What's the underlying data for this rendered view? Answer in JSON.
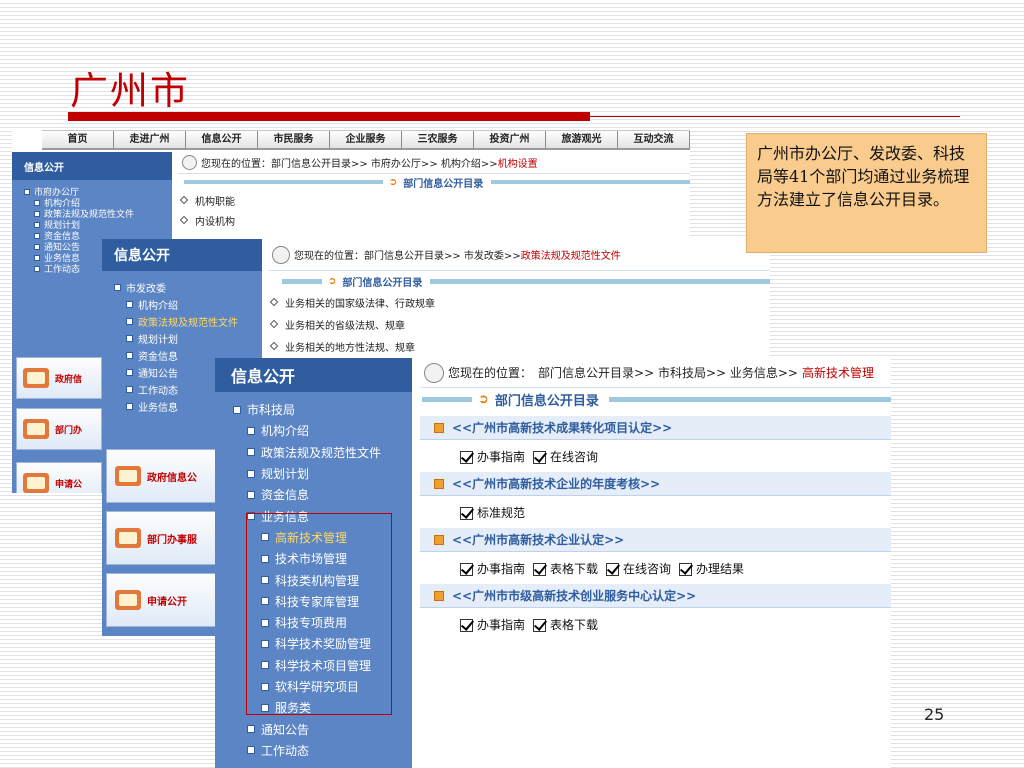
{
  "slide": {
    "title": "广州市",
    "page_number": "25",
    "note": "广州市办公厅、发改委、科技局等41个部门均通过业务梳理方法建立了信息公开目录。"
  },
  "screenshot1": {
    "nav": [
      "首页",
      "走进广州",
      "信息公开",
      "市民服务",
      "企业服务",
      "三农服务",
      "投资广州",
      "旅游观光",
      "互动交流"
    ],
    "side_title": "信息公开",
    "tree": [
      "市府办公厅",
      "机构介绍",
      "政策法规及规范性文件",
      "规划计划",
      "资金信息",
      "通知公告",
      "业务信息",
      "工作动态"
    ],
    "promos": [
      "政府信",
      "部门办",
      "申请公"
    ],
    "breadcrumb": {
      "prefix": "您现在的位置：",
      "path": "部门信息公开目录>> 市府办公厅>> 机构介绍>>",
      "current": "机构设置"
    },
    "dir_title": "部门信息公开目录",
    "links": [
      "机构职能",
      "内设机构"
    ]
  },
  "screenshot2": {
    "side_title": "信息公开",
    "tree": [
      "市发改委",
      "机构介绍",
      "政策法规及规范性文件",
      "规划计划",
      "资金信息",
      "通知公告",
      "工作动态",
      "业务信息"
    ],
    "promos": [
      "政府信息公",
      "部门办事服",
      "申请公开"
    ],
    "breadcrumb": {
      "prefix": "您现在的位置：",
      "path": "部门信息公开目录>> 市发改委>>",
      "current": "政策法规及规范性文件"
    },
    "dir_title": "部门信息公开目录",
    "links": [
      "业务相关的国家级法律、行政规章",
      "业务相关的省级法规、规章",
      "业务相关的地方性法规、规章"
    ]
  },
  "screenshot3": {
    "side_title": "信息公开",
    "tree": [
      "市科技局",
      "机构介绍",
      "政策法规及规范性文件",
      "规划计划",
      "资金信息",
      "业务信息",
      "高新技术管理",
      "技术市场管理",
      "科技类机构管理",
      "科技专家库管理",
      "科技专项费用",
      "科学技术奖励管理",
      "科学技术项目管理",
      "软科学研究项目",
      "服务类",
      "通知公告",
      "工作动态"
    ],
    "breadcrumb": {
      "prefix": "您现在的位置：",
      "path": "部门信息公开目录>> 市科技局>> 业务信息>>",
      "current": "高新技术管理"
    },
    "dir_title": "部门信息公开目录",
    "sections": [
      {
        "title": "<<广州市高新技术成果转化项目认定>>",
        "links": [
          "办事指南",
          "在线咨询"
        ]
      },
      {
        "title": "<<广州市高新技术企业的年度考核>>",
        "links": [
          "标准规范"
        ]
      },
      {
        "title": "<<广州市高新技术企业认定>>",
        "links": [
          "办事指南",
          "表格下载",
          "在线咨询",
          "办理结果"
        ]
      },
      {
        "title": "<<广州市市级高新技术创业服务中心认定>>",
        "links": [
          "办事指南",
          "表格下载"
        ]
      }
    ]
  },
  "colors": {
    "title_red": "#c00000",
    "sidebar_blue": "#5b85c4",
    "note_bg": "#f9cc8e"
  }
}
